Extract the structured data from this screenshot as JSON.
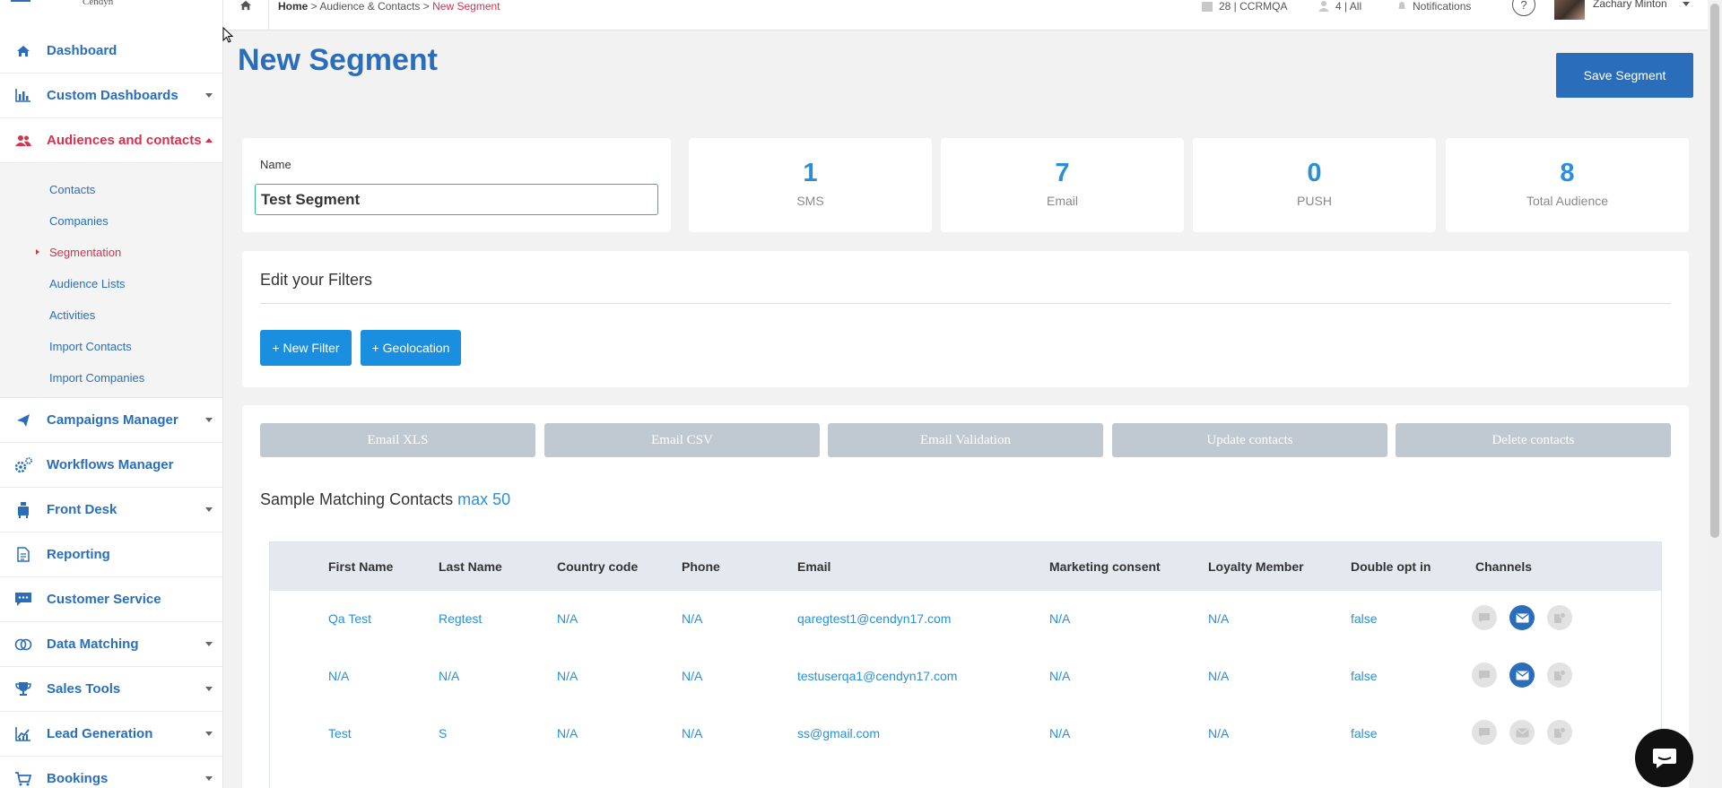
{
  "sidebar": {
    "logo": "Cendyn",
    "items": [
      {
        "label": "Dashboard",
        "icon": "home-icon"
      },
      {
        "label": "Custom Dashboards",
        "icon": "bar-chart-icon"
      },
      {
        "label": "Audiences and contacts",
        "icon": "users-icon"
      },
      {
        "label": "Campaigns Manager",
        "icon": "paper-plane-icon"
      },
      {
        "label": "Workflows Manager",
        "icon": "gears-icon"
      },
      {
        "label": "Front Desk",
        "icon": "bellboy-icon"
      },
      {
        "label": "Reporting",
        "icon": "document-icon"
      },
      {
        "label": "Customer Service",
        "icon": "chat-icon"
      },
      {
        "label": "Data Matching",
        "icon": "match-icon"
      },
      {
        "label": "Sales Tools",
        "icon": "trophy-icon"
      },
      {
        "label": "Lead Generation",
        "icon": "growth-chart-icon"
      },
      {
        "label": "Bookings",
        "icon": "cart-icon"
      }
    ],
    "submenu": [
      "Contacts",
      "Companies",
      "Segmentation",
      "Audience Lists",
      "Activities",
      "Import Contacts",
      "Import Companies"
    ]
  },
  "topbar": {
    "breadcrumb": {
      "home": "Home",
      "sep1": " > ",
      "middle": "Audience & Contacts",
      "sep2": " > ",
      "current": "New Segment"
    },
    "property": "28 | CCRMQA",
    "audience": "4 | All",
    "notifications": "Notifications",
    "help": "?",
    "user": "Zachary Minton"
  },
  "page": {
    "title": "New Segment",
    "save_label": "Save Segment"
  },
  "name_card": {
    "label": "Name",
    "value": "Test Segment"
  },
  "stats": [
    {
      "value": "1",
      "label": "SMS"
    },
    {
      "value": "7",
      "label": "Email"
    },
    {
      "value": "0",
      "label": "PUSH"
    },
    {
      "value": "8",
      "label": "Total Audience"
    }
  ],
  "filters": {
    "title": "Edit your Filters",
    "new_filter": "+ New Filter",
    "geolocation": "+ Geolocation"
  },
  "actions": [
    "Email XLS",
    "Email CSV",
    "Email Validation",
    "Update contacts",
    "Delete contacts"
  ],
  "sample": {
    "title": "Sample Matching Contacts",
    "max": "max 50"
  },
  "table": {
    "columns": [
      "First Name",
      "Last Name",
      "Country code",
      "Phone",
      "Email",
      "Marketing consent",
      "Loyalty Member",
      "Double opt in",
      "Channels"
    ],
    "rows": [
      {
        "first": "Qa Test",
        "last": "Regtest",
        "country": "N/A",
        "phone": "N/A",
        "email": "qaregtest1@cendyn17.com",
        "consent": "N/A",
        "loyalty": "N/A",
        "optin": "false",
        "email_channel": true
      },
      {
        "first": "N/A",
        "last": "N/A",
        "country": "N/A",
        "phone": "N/A",
        "email": "testuserqa1@cendyn17.com",
        "consent": "N/A",
        "loyalty": "N/A",
        "optin": "false",
        "email_channel": true
      },
      {
        "first": "Test",
        "last": "S",
        "country": "N/A",
        "phone": "N/A",
        "email": "ss@gmail.com",
        "consent": "N/A",
        "loyalty": "N/A",
        "optin": "false",
        "email_channel": false
      }
    ]
  },
  "colors": {
    "brand_blue": "#2a6ebb",
    "active_red": "#d6324e",
    "accent_blue": "#1a8fe0",
    "input_border": "#2bb39b"
  }
}
